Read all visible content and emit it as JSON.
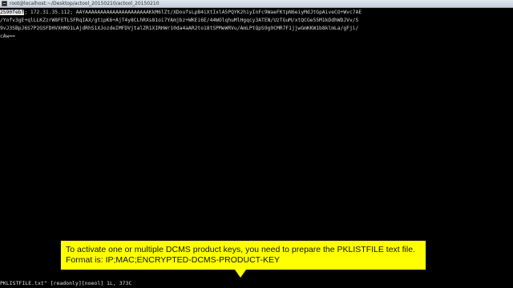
{
  "window": {
    "title": "root@localhost:~/Desktop/actool_20150210/actool_20150210"
  },
  "terminal": {
    "line1_selected": "2590febf",
    "line1_rest": "; 172.31.35.112; AAYAAAAAAAAAAAAAAAAAAAAAKkM6lZt/XDoufsLpB4iXtIxlA5PQYK2hiyInFc9WaeFKtpN6eiyMdJtGpAiveCO+Wvc7AE",
    "line2": "/Yofv3gE+qlLLKZzrW8FETLSFRqIAX/gtipK6+AjT4y8CLhRXs81oi7YAmjbz+WKEi6E/44WOlqhuMlHgqcy3ATEN/UzTGuM/xtQCGe55M1kDdhWDJVv/S",
    "line3": "9vJ3SBpJ6S7P2GSFDHVXHMO1LAjdRhS1XJozdeIMFDVjtalZR1XIRHWr10da4aAR2to18tSPMeWRVu/AmLPtQpS9g9CMR7F1jjwGmKKW1b8klmLa/gFji/",
    "line4": "cAw=="
  },
  "status_bar": {
    "text": "PKLISTFILE.txt\" [readonly][noeol] 1L, 373C"
  },
  "callout": {
    "line1": "To activate one or multiple DCMS product keys, you need to prepare the PKLISTFILE text file.",
    "line2": "Format is: IP;MAC;ENCRYPTED-DCMS-PRODUCT-KEY"
  }
}
